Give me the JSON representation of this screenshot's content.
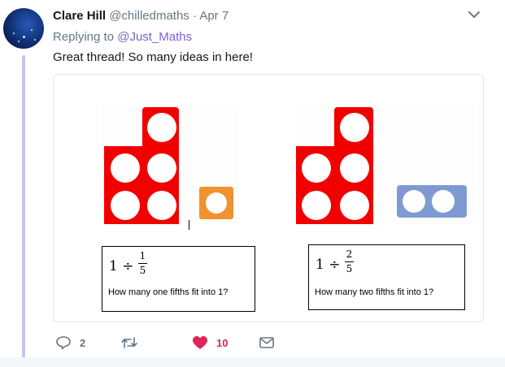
{
  "tweet": {
    "name": "Clare Hill",
    "handle": "@chilledmaths",
    "separator": "·",
    "date": "Apr 7",
    "replying_prefix": "Replying to",
    "replying_to": "@Just_Maths",
    "text": "Great thread! So many ideas in here!"
  },
  "card": {
    "left_question": {
      "expression": "1 ÷",
      "numerator": "1",
      "denominator": "5",
      "text": "How many one fifths fit into 1?"
    },
    "right_question": {
      "expression": "1 ÷",
      "numerator": "2",
      "denominator": "5",
      "text": "How many two fifths fit into 1?"
    }
  },
  "actions": {
    "replies": "2",
    "likes": "10"
  },
  "icons": {
    "menu": "chevron-down-icon",
    "reply": "reply-icon",
    "retweet": "retweet-icon",
    "like": "heart-icon",
    "message": "envelope-icon"
  },
  "colors": {
    "numicon_red": "#f20000",
    "one_square": "#f0922d",
    "two_bar": "#7f9ad3",
    "like": "#e0245e",
    "mention": "#7b62c9"
  }
}
